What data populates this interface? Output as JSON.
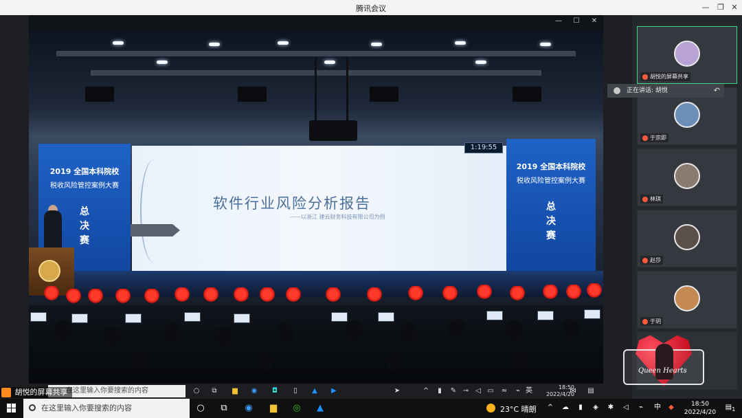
{
  "window": {
    "title": "腾讯会议",
    "min_glyph": "—",
    "max_glyph": "❐",
    "close_glyph": "✕"
  },
  "shared_window": {
    "min_glyph": "—",
    "max_glyph": "☐",
    "close_glyph": "✕"
  },
  "slide": {
    "report_title": "软件行业风险分析报告",
    "report_sub": "——以浙江 建云财务科技有限公司为例",
    "banner_year": "2019 全国本科院校",
    "banner_line": "税收风险管控案例大赛",
    "banner_final": [
      "总",
      "决",
      "赛"
    ],
    "timer": "1:19:55"
  },
  "inner_taskbar": {
    "search_placeholder": "在这里输入你要搜索的内容",
    "time": "18:50",
    "date": "2022/4/20"
  },
  "share_label": "胡悦的屏幕共享",
  "participants": [
    {
      "name": "胡悦的屏幕共享",
      "active": true,
      "avatar_color": "#b9a3d6"
    },
    {
      "name": "于宗即",
      "active": false,
      "avatar_color": "#6c8fb8"
    },
    {
      "name": "林琪",
      "active": false,
      "avatar_color": "#8b7a70"
    },
    {
      "name": "赵莎",
      "active": false,
      "avatar_color": "#5c5148"
    },
    {
      "name": "于玥",
      "active": false,
      "avatar_color": "#c48a52"
    }
  ],
  "speaking": {
    "label": "正在讲话: 胡悦",
    "reply_icon": "reply-icon"
  },
  "sticker": {
    "text": "Queen Hearts"
  },
  "taskbar": {
    "search_placeholder": "在这里输入你要搜索的内容",
    "weather": "23°C 晴朗",
    "ime": "中",
    "time": "18:50",
    "date": "2022/4/20",
    "notification_count": "1"
  }
}
